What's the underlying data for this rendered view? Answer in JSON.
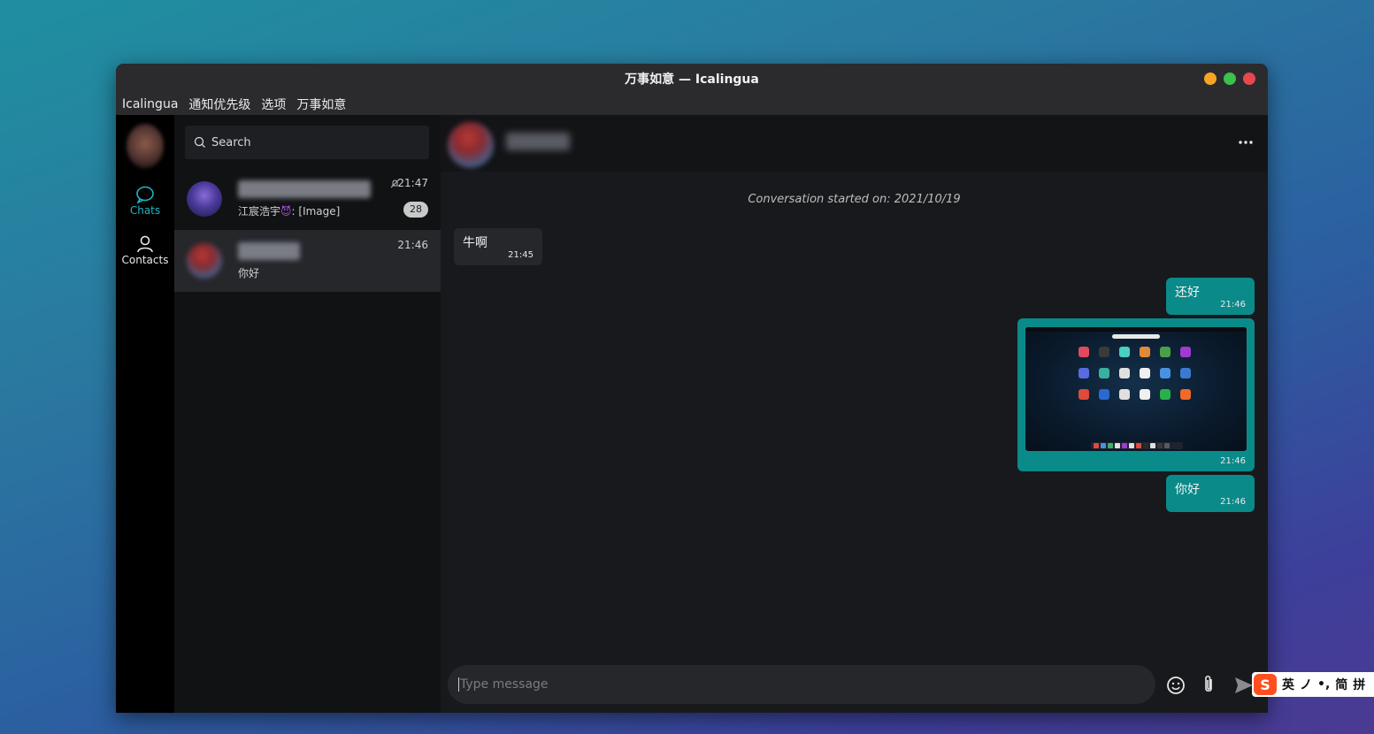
{
  "window": {
    "title": "万事如意 — Icalingua",
    "controls": {
      "minimize_color": "#f5a623",
      "maximize_color": "#3cc14a",
      "close_color": "#e5484d"
    }
  },
  "menu": [
    "Icalingua",
    "通知优先级",
    "选项",
    "万事如意"
  ],
  "rail": {
    "chats_label": "Chats",
    "contacts_label": "Contacts",
    "accent": "#1fb6c9"
  },
  "search": {
    "placeholder": "Search"
  },
  "chats": [
    {
      "preview_sender": "江宸浩宇",
      "preview_text": ": [Image]",
      "time": "21:47",
      "unread": "28",
      "muted": true
    },
    {
      "preview_text": "你好",
      "time": "21:46",
      "active": true
    }
  ],
  "conversation": {
    "started": "Conversation started on: 2021/10/19",
    "messages": [
      {
        "dir": "in",
        "text": "牛啊",
        "time": "21:45"
      },
      {
        "dir": "out",
        "text": "还好",
        "time": "21:46"
      },
      {
        "dir": "out",
        "type": "image",
        "time": "21:46"
      },
      {
        "dir": "out",
        "text": "你好",
        "time": "21:46"
      }
    ]
  },
  "composer": {
    "placeholder": "Type message",
    "icons": [
      "emoji-icon",
      "attachment-icon",
      "send-icon"
    ]
  },
  "ime": {
    "logo": "S",
    "items": [
      "英",
      "ノ",
      "•,",
      "简",
      "拼"
    ]
  },
  "colors": {
    "outgoing": "#0b8a8a",
    "incoming": "#26272b",
    "accent": "#1fb6c9"
  }
}
